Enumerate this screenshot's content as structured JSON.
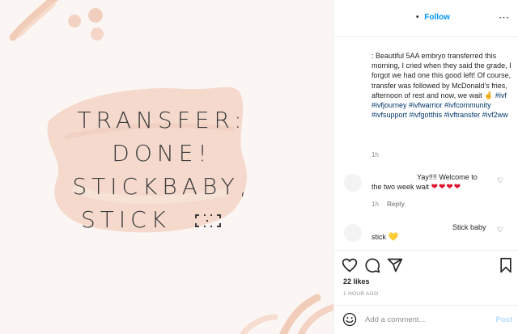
{
  "post": {
    "headline_lines": [
      "TRANSFER:",
      "DONE!",
      "STICKBABY,",
      "STICK"
    ]
  },
  "header": {
    "follow_label": "Follow",
    "more_icon": "more-icon"
  },
  "caption": {
    "text_plain": ": Beautiful 5AA embryo transferred this morning, I cried when they said the grade, I forgot we had one this good left! Of course, transfer was followed by McDonald's fries, afternoon of rest and now, we wait",
    "hashtags": [
      "#ivf",
      "#ivfjourney",
      "#ivfwarrior",
      "#ivfcommunity",
      "#ivfsupport",
      "#ivfgotthis",
      "#ivftransfer",
      "#ivf2ww"
    ],
    "time": "1h"
  },
  "comments": [
    {
      "text_line1": "Yay!!!! Welcome to",
      "text_line2": "the two week wait",
      "emoji": "❤❤❤❤",
      "time": "1h",
      "reply_label": "Reply"
    },
    {
      "text_line1": "Stick baby",
      "text_line2": "stick",
      "emoji": "💛"
    }
  ],
  "actions": {
    "likes": "22 likes",
    "time_ago": "1 HOUR AGO"
  },
  "add_comment": {
    "placeholder": "Add a comment...",
    "post_label": "Post"
  },
  "colors": {
    "link_blue": "#0095f6",
    "hashtag_blue": "#00376b",
    "post_disabled": "#b3dbff",
    "brush_peach": "#f3d7c9"
  }
}
